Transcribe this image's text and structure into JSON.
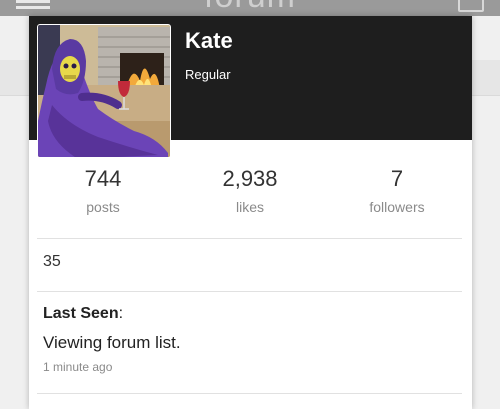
{
  "background": {
    "title": "forum"
  },
  "profile": {
    "name": "Kate",
    "rank": "Regular",
    "stats": [
      {
        "value": "744",
        "label": "posts"
      },
      {
        "value": "2,938",
        "label": "likes"
      },
      {
        "value": "7",
        "label": "followers"
      }
    ],
    "reputation": "35",
    "last_seen": {
      "label": "Last Seen",
      "separator": ":",
      "status": "Viewing forum list.",
      "time": "1 minute ago"
    }
  },
  "colors": {
    "header_bg": "#1e1e1e",
    "card_bg": "#ffffff",
    "muted_text": "#8a8a8a",
    "dark_text": "#333333"
  }
}
